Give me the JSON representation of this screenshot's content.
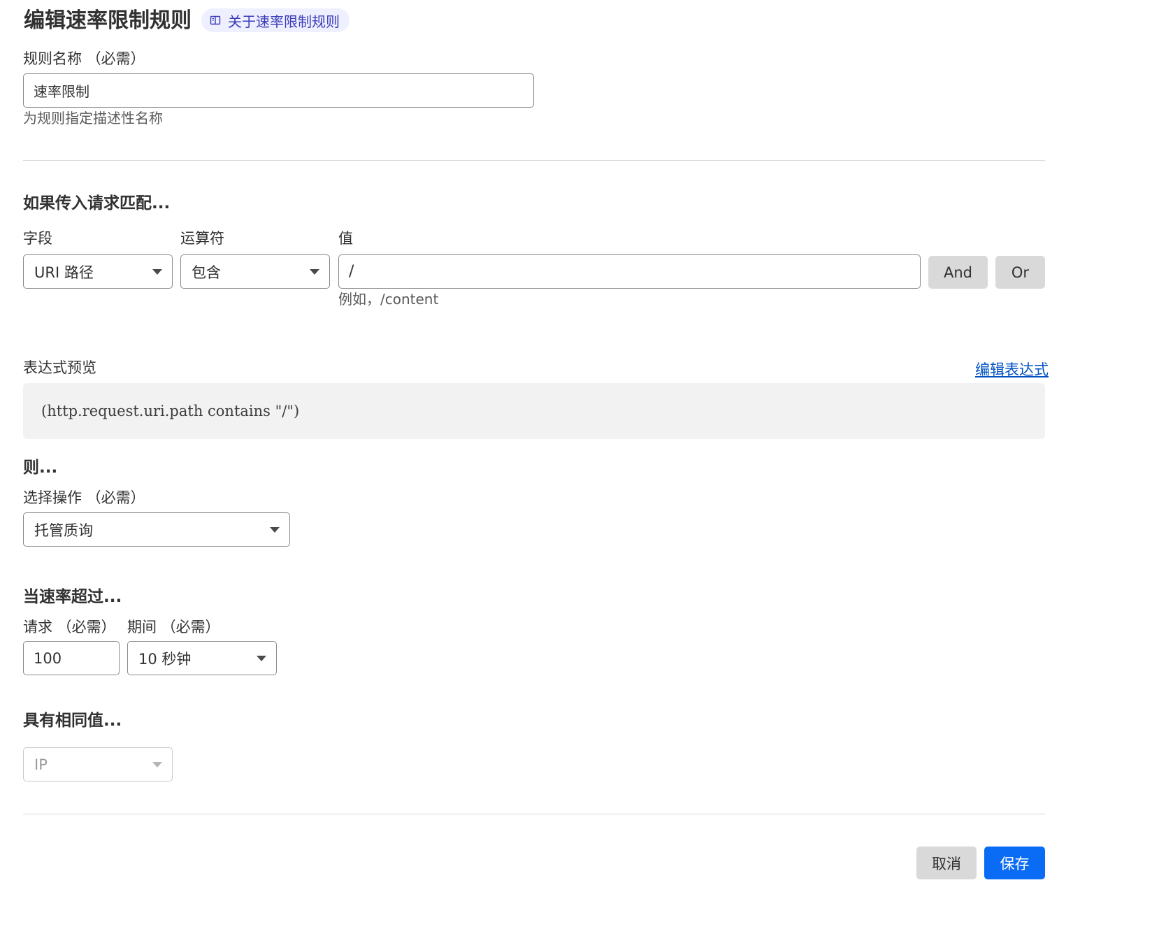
{
  "header": {
    "title": "编辑速率限制规则",
    "doc_link_label": "关于速率限制规则"
  },
  "rule_name": {
    "label": "规则名称 （必需）",
    "value": "速率限制",
    "help": "为规则指定描述性名称"
  },
  "match": {
    "heading": "如果传入请求匹配...",
    "field_label": "字段",
    "operator_label": "运算符",
    "value_label": "值",
    "field_value": "URI 路径",
    "operator_value": "包含",
    "value_input": "/",
    "value_help": "例如，/content",
    "and_label": "And",
    "or_label": "Or"
  },
  "expression": {
    "label": "表达式预览",
    "edit_link": "编辑表达式",
    "preview": "(http.request.uri.path contains \"/\")"
  },
  "then": {
    "heading": "则...",
    "action_label": "选择操作 （必需）",
    "action_value": "托管质询"
  },
  "rate": {
    "heading": "当速率超过...",
    "requests_label": "请求 （必需）",
    "period_label": "期间 （必需）",
    "requests_value": "100",
    "period_value": "10 秒钟"
  },
  "same_value": {
    "heading": "具有相同值...",
    "characteristic_value": "IP"
  },
  "footer": {
    "cancel_label": "取消",
    "save_label": "保存"
  },
  "colors": {
    "primary": "#0a6cf5",
    "link": "#0051c3",
    "pill_bg": "#eef0ff"
  }
}
